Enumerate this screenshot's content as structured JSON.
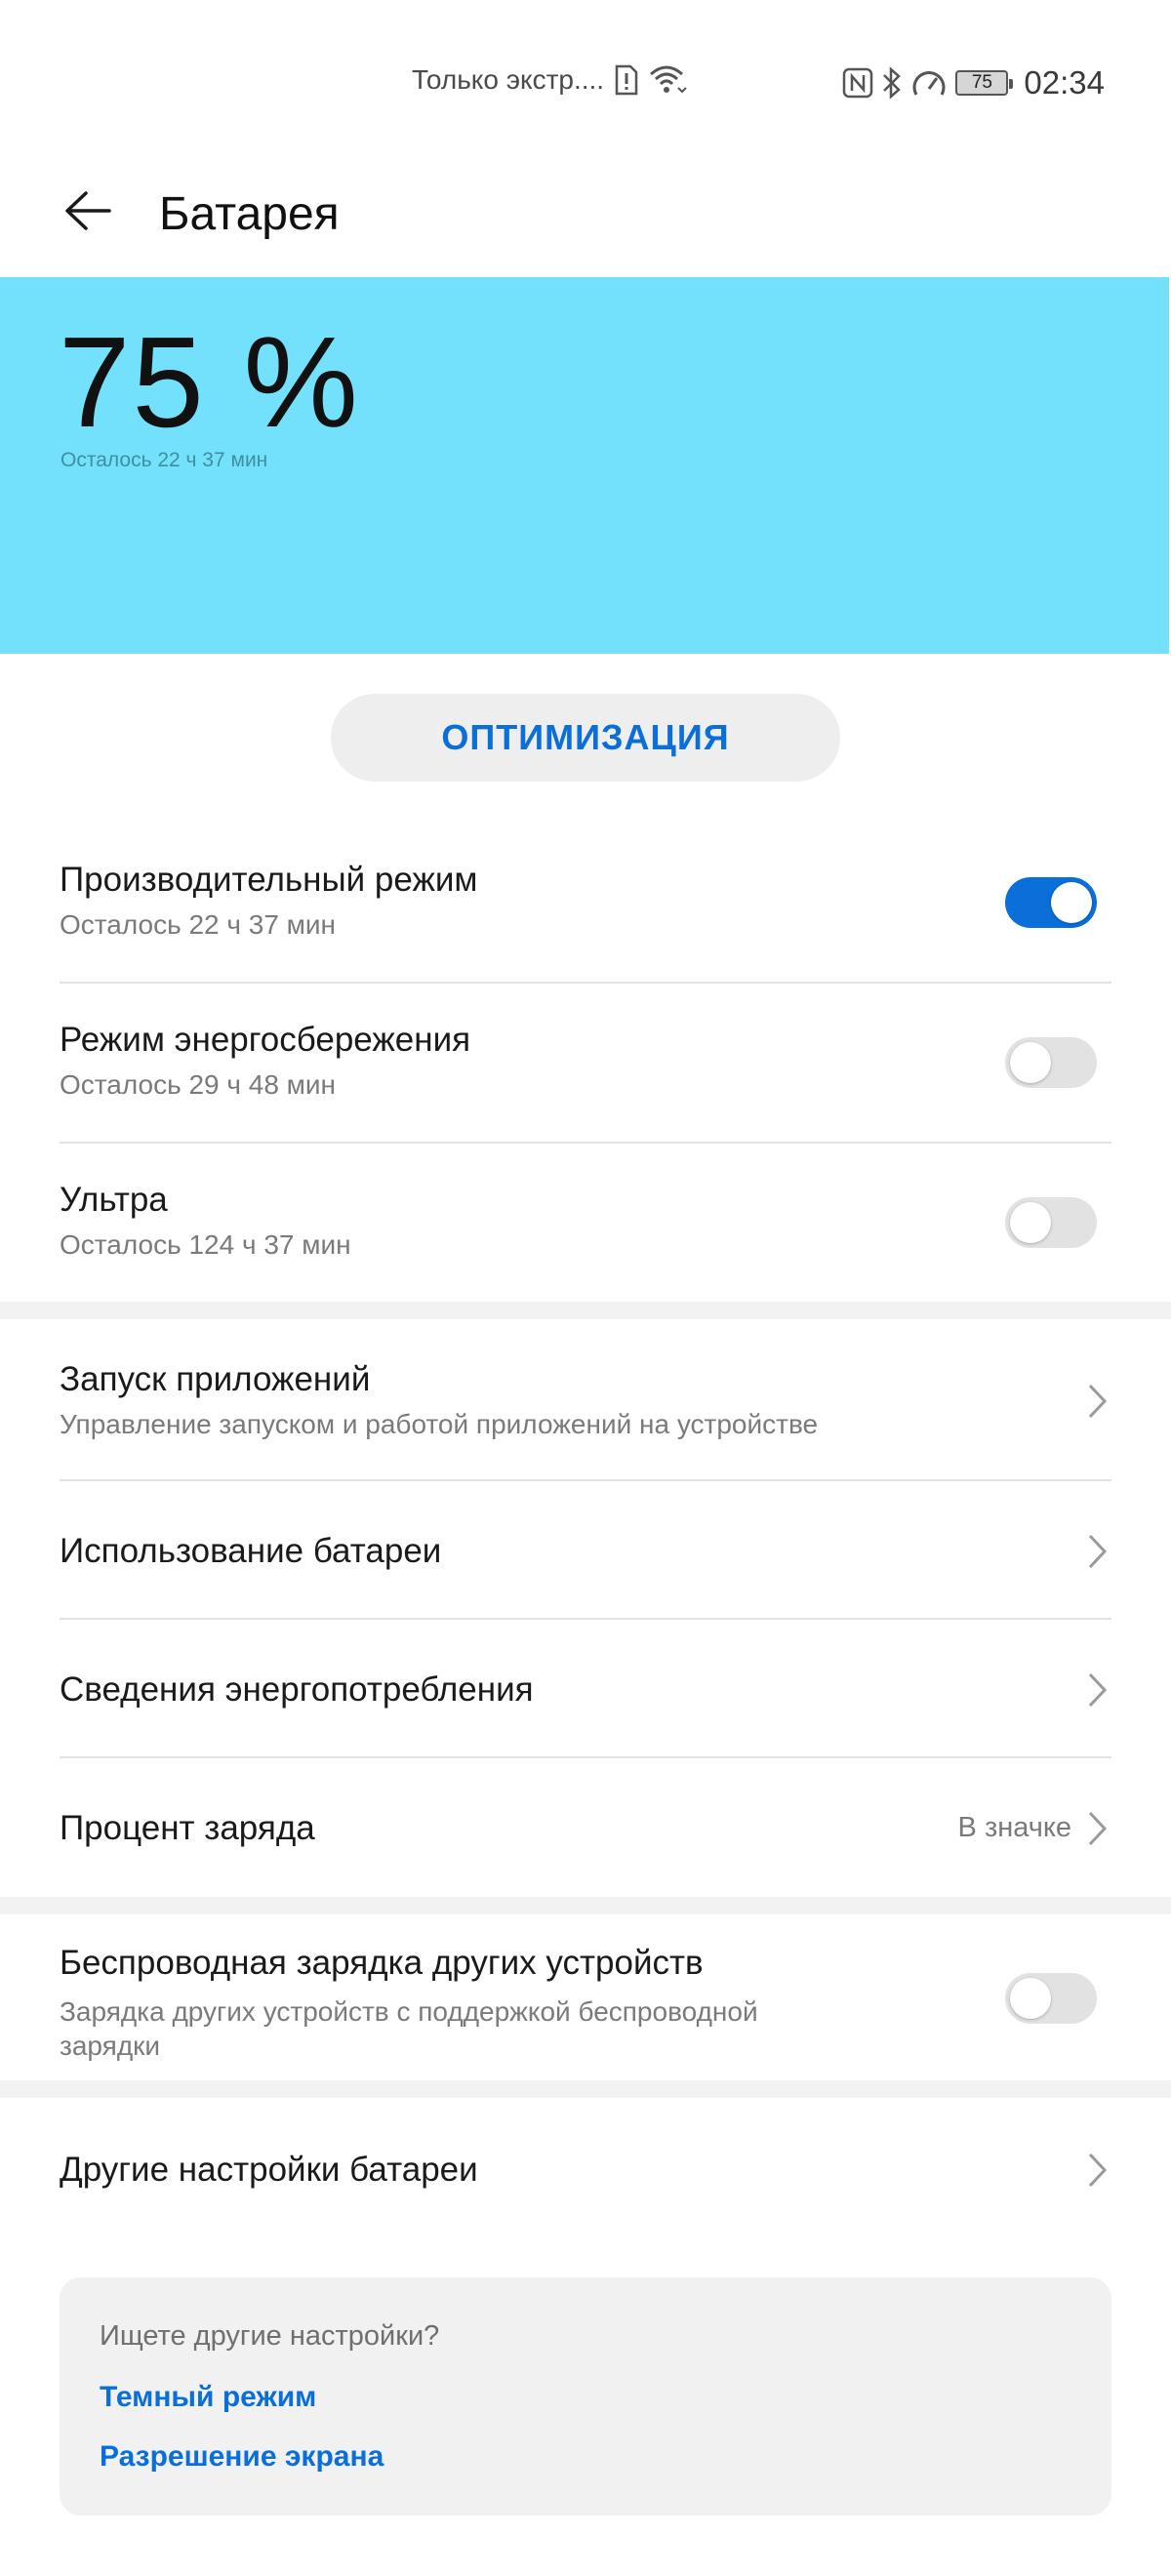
{
  "status_bar": {
    "notice": "Только экстр....",
    "battery_level": "75",
    "time": "02:34"
  },
  "header": {
    "title": "Батарея"
  },
  "hero": {
    "percent": "75 %",
    "remaining": "Осталось 22 ч 37 мин",
    "background_color": "#73e1fb"
  },
  "optimize_button": "ОПТИМИЗАЦИЯ",
  "modes": [
    {
      "title": "Производительный режим",
      "subtitle": "Осталось 22 ч 37 мин",
      "enabled": true
    },
    {
      "title": "Режим энергосбережения",
      "subtitle": "Осталось 29 ч 48 мин",
      "enabled": false
    },
    {
      "title": "Ультра",
      "subtitle": "Осталось 124 ч 37 мин",
      "enabled": false
    }
  ],
  "settings": [
    {
      "title": "Запуск приложений",
      "subtitle": "Управление запуском и работой приложений на устройстве"
    },
    {
      "title": "Использование батареи"
    },
    {
      "title": "Сведения энергопотребления"
    },
    {
      "title": "Процент заряда",
      "value": "В значке"
    }
  ],
  "wireless": {
    "title": "Беспроводная зарядка других устройств",
    "subtitle_line1": "Зарядка других устройств с поддержкой беспроводной",
    "subtitle_line2": "зарядки",
    "enabled": false
  },
  "other": {
    "title": "Другие настройки батареи"
  },
  "suggestions": {
    "question": "Ищете другие настройки?",
    "links": [
      "Темный режим",
      "Разрешение экрана"
    ]
  },
  "colors": {
    "accent": "#0a6fd9",
    "toggle_off": "#e2e2e2"
  }
}
